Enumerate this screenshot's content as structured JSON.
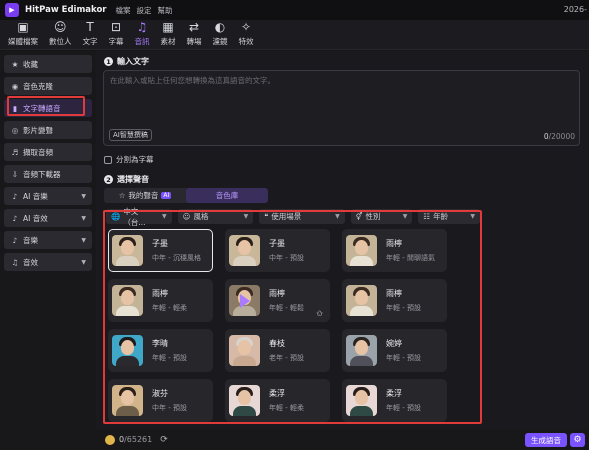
{
  "app": {
    "name": "HitPaw Edimakor",
    "menu": [
      "檔案",
      "設定",
      "幫助"
    ],
    "date_fragment": "2026-"
  },
  "toolbar": [
    {
      "label": "媒體檔案",
      "icon": "media-file-icon",
      "glyph": "▣",
      "active": false
    },
    {
      "label": "數位人",
      "icon": "digital-human-icon",
      "glyph": "☺",
      "active": false
    },
    {
      "label": "文字",
      "icon": "text-icon",
      "glyph": "T",
      "active": false
    },
    {
      "label": "字幕",
      "icon": "subtitle-icon",
      "glyph": "⊡",
      "active": false
    },
    {
      "label": "音訊",
      "icon": "audio-note-icon",
      "glyph": "♫",
      "active": true
    },
    {
      "label": "素材",
      "icon": "sticker-icon",
      "glyph": "▦",
      "active": false
    },
    {
      "label": "轉場",
      "icon": "transition-icon",
      "glyph": "⇄",
      "active": false
    },
    {
      "label": "濾鏡",
      "icon": "filter-icon",
      "glyph": "◐",
      "active": false
    },
    {
      "label": "特效",
      "icon": "effect-icon",
      "glyph": "✧",
      "active": false
    }
  ],
  "sidebar": {
    "items": [
      {
        "label": "收藏",
        "icon": "star-icon",
        "glyph": "★",
        "chevron": false,
        "active": false
      },
      {
        "label": "音色克隆",
        "icon": "voice-clone-icon",
        "glyph": "◉",
        "chevron": false,
        "active": false
      },
      {
        "label": "文字轉語音",
        "icon": "text-to-speech-icon",
        "glyph": "▮",
        "chevron": false,
        "active": true
      },
      {
        "label": "影片變聲",
        "icon": "video-voice-change-icon",
        "glyph": "◎",
        "chevron": false,
        "active": false
      },
      {
        "label": "擷取音頻",
        "icon": "extract-audio-icon",
        "glyph": "♬",
        "chevron": false,
        "active": false
      },
      {
        "label": "音頻下載器",
        "icon": "audio-downloader-icon",
        "glyph": "⇩",
        "chevron": false,
        "active": false
      },
      {
        "label": "AI 音樂",
        "icon": "ai-music-icon",
        "glyph": "♪",
        "chevron": true,
        "active": false
      },
      {
        "label": "AI 音效",
        "icon": "ai-sound-effect-icon",
        "glyph": "♪",
        "chevron": true,
        "active": false
      },
      {
        "label": "音樂",
        "icon": "music-icon",
        "glyph": "♪",
        "chevron": true,
        "active": false
      },
      {
        "label": "音效",
        "icon": "sound-effect-icon",
        "glyph": "♫",
        "chevron": true,
        "active": false
      }
    ]
  },
  "input_section": {
    "number": "1",
    "title": "輸入文字",
    "placeholder": "在此輸入或貼上任何您想轉換為這真語音的文字。",
    "ai_button": "AI智慧撰稿",
    "counter_current": "0",
    "counter_max": "/20000",
    "split_checkbox": "分割為字幕"
  },
  "voice_section": {
    "number": "2",
    "title": "選擇聲音",
    "tabs": [
      {
        "label": "我的聲音",
        "badge": "AI",
        "active": false
      },
      {
        "label": "音色庫",
        "badge": "",
        "active": true
      }
    ],
    "filters": [
      {
        "label": "中文（台...",
        "icon": "globe-icon",
        "glyph": "🌐"
      },
      {
        "label": "風格",
        "icon": "smile-icon",
        "glyph": "☺"
      },
      {
        "label": "使用場景",
        "icon": "quote-icon",
        "glyph": "❝"
      },
      {
        "label": "性別",
        "icon": "gender-icon",
        "glyph": "⚥"
      },
      {
        "label": "年齡",
        "icon": "age-icon",
        "glyph": "☷"
      }
    ],
    "voices": [
      {
        "name": "子墨",
        "desc": "中年 - 沉穩風格",
        "selected": true,
        "playing": false,
        "favorite": false,
        "bg": "#c9b79a",
        "hair": "#2b2019",
        "shirt": "#d9d0c0"
      },
      {
        "name": "子墨",
        "desc": "中年 - 預設",
        "selected": false,
        "playing": false,
        "favorite": false,
        "bg": "#c9b79a",
        "hair": "#2b2019",
        "shirt": "#d9d0c0"
      },
      {
        "name": "雨檸",
        "desc": "年輕 - 閒聊語氣",
        "selected": false,
        "playing": false,
        "favorite": false,
        "bg": "#c4b497",
        "hair": "#3a2a20",
        "shirt": "#e8e2d4"
      },
      {
        "name": "雨檸",
        "desc": "年輕 - 輕柔",
        "selected": false,
        "playing": false,
        "favorite": false,
        "bg": "#c4b497",
        "hair": "#3a2a20",
        "shirt": "#e8e2d4"
      },
      {
        "name": "雨檸",
        "desc": "年輕 - 輕鬆",
        "selected": false,
        "playing": true,
        "favorite": true,
        "bg": "#8a7a66",
        "hair": "#3a2a20",
        "shirt": "#b8ae9c"
      },
      {
        "name": "雨檸",
        "desc": "年輕 - 預設",
        "selected": false,
        "playing": false,
        "favorite": false,
        "bg": "#c4b497",
        "hair": "#3a2a20",
        "shirt": "#e8e2d4"
      },
      {
        "name": "李晴",
        "desc": "年輕 - 預設",
        "selected": false,
        "playing": false,
        "favorite": false,
        "bg": "#3fa7c8",
        "hair": "#1c1a1a",
        "shirt": "#2a2a2e"
      },
      {
        "name": "春枝",
        "desc": "老年 - 預設",
        "selected": false,
        "playing": false,
        "favorite": false,
        "bg": "#d7b9a7",
        "hair": "#d8d2cc",
        "shirt": "#c8a890"
      },
      {
        "name": "婉婷",
        "desc": "年輕 - 預設",
        "selected": false,
        "playing": false,
        "favorite": false,
        "bg": "#9aa2aa",
        "hair": "#2a2420",
        "shirt": "#50505a"
      },
      {
        "name": "淑芬",
        "desc": "中年 - 預設",
        "selected": false,
        "playing": false,
        "favorite": false,
        "bg": "#d2b48a",
        "hair": "#2a1e16",
        "shirt": "#6d5e4a"
      },
      {
        "name": "柔浮",
        "desc": "年輕 - 輕柔",
        "selected": false,
        "playing": false,
        "favorite": false,
        "bg": "#e7d8d5",
        "hair": "#2a1e1a",
        "shirt": "#2f4a44"
      },
      {
        "name": "柔浮",
        "desc": "年輕 - 預設",
        "selected": false,
        "playing": false,
        "favorite": false,
        "bg": "#e7d8d5",
        "hair": "#2a1e1a",
        "shirt": "#2f4a44"
      }
    ]
  },
  "footer": {
    "credits_current": "0",
    "credits_total": "/65261",
    "generate_button": "生成語音"
  },
  "colors": {
    "accent": "#7a52ff",
    "highlight_box": "#e03a3a"
  }
}
